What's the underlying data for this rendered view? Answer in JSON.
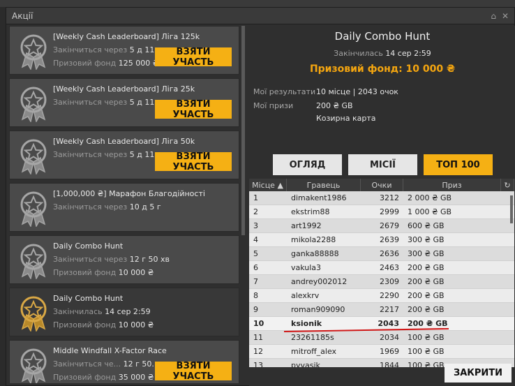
{
  "window": {
    "title": "Акції"
  },
  "cards": [
    {
      "title": "[Weekly Cash Leaderboard] Ліга 125k",
      "line1_label": "Закінчиться через",
      "line1_value": "5 д 11 г",
      "line2_label": "Призовий фонд",
      "line2_value": "125 000 ₴",
      "button": "ВЗЯТИ УЧАСТЬ",
      "medal": "silver"
    },
    {
      "title": "[Weekly Cash Leaderboard] Ліга 25k",
      "line1_label": "Закінчиться через",
      "line1_value": "5 д 11 г",
      "line2_label": "",
      "line2_value": "",
      "button": "ВЗЯТИ УЧАСТЬ",
      "medal": "silver"
    },
    {
      "title": "[Weekly Cash Leaderboard] Ліга 50k",
      "line1_label": "Закінчиться через",
      "line1_value": "5 д 11 г",
      "line2_label": "",
      "line2_value": "",
      "button": "ВЗЯТИ УЧАСТЬ",
      "medal": "silver"
    },
    {
      "title": "[1,000,000 ₴] Марафон Благодійності",
      "line1_label": "Закінчиться через",
      "line1_value": "10 д 5 г",
      "line2_label": "",
      "line2_value": "",
      "button": "",
      "medal": "silver"
    },
    {
      "title": "Daily Combo Hunt",
      "line1_label": "Закінчиться через",
      "line1_value": "12 г 50 хв",
      "line2_label": "Призовий фонд",
      "line2_value": "10 000 ₴",
      "button": "",
      "medal": "silver"
    },
    {
      "title": "Daily Combo Hunt",
      "line1_label": "Закінчилась",
      "line1_value": "14 сер 2:59",
      "line2_label": "Призовий фонд",
      "line2_value": "10 000 ₴",
      "button": "",
      "medal": "gold",
      "selected": true
    },
    {
      "title": "Middle Windfall X-Factor Race",
      "line1_label": "Закінчиться че...",
      "line1_value": "12 г 50...",
      "line2_label": "Призовий фонд",
      "line2_value": "35 000 ₴",
      "button": "ВЗЯТИ УЧАСТЬ",
      "medal": "silver"
    }
  ],
  "detail": {
    "title": "Daily Combo Hunt",
    "ended_label": "Закінчилась",
    "ended_value": "14 сер 2:59",
    "prize": "Призовий фонд: 10 000 ₴",
    "results_label": "Мої результати",
    "results_value": "10 місце | 2043 очок",
    "prizes_label": "Мої призи",
    "prizes_value1": "200 ₴ GB",
    "prizes_value2": "Козирна карта",
    "tabs": [
      "ОГЛЯД",
      "МІСІЇ",
      "ТОП 100"
    ],
    "active_tab": 2
  },
  "table": {
    "headers": [
      "Місце ▲",
      "Гравець",
      "Очки",
      "Приз",
      "↻"
    ],
    "rows": [
      [
        "1",
        "dimakent1986",
        "3212",
        "2 000 ₴ GB"
      ],
      [
        "2",
        "ekstrim88",
        "2999",
        "1 000 ₴ GB"
      ],
      [
        "3",
        "art1992",
        "2679",
        "600 ₴ GB"
      ],
      [
        "4",
        "mikola2288",
        "2639",
        "300 ₴ GB"
      ],
      [
        "5",
        "ganka88888",
        "2636",
        "300 ₴ GB"
      ],
      [
        "6",
        "vakula3",
        "2463",
        "200 ₴ GB"
      ],
      [
        "7",
        "andrey002012",
        "2309",
        "200 ₴ GB"
      ],
      [
        "8",
        "alexkrv",
        "2290",
        "200 ₴ GB"
      ],
      [
        "9",
        "roman909090",
        "2217",
        "200 ₴ GB"
      ],
      [
        "10",
        "ksionik",
        "2043",
        "200 ₴ GB"
      ],
      [
        "11",
        "23261185s",
        "2034",
        "100 ₴ GB"
      ],
      [
        "12",
        "mitroff_alex",
        "1969",
        "100 ₴ GB"
      ],
      [
        "13",
        "pyvasik",
        "1844",
        "100 ₴ GB"
      ]
    ],
    "highlight_index": 9
  },
  "close_button": "ЗАКРИТИ",
  "colors": {
    "accent": "#f5b014",
    "prize": "#f5a60f",
    "underline": "#d01818"
  }
}
